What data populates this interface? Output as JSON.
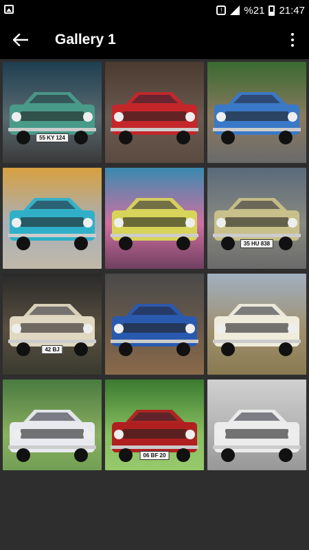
{
  "status_bar": {
    "battery_percent": "%21",
    "time": "21:47"
  },
  "app_bar": {
    "title": "Gallery 1",
    "back_icon": "arrow-left-icon",
    "more_icon": "more-vert-icon"
  },
  "gallery": {
    "items": [
      {
        "plate": "55 KY 124",
        "car_color": "#4a9a8a"
      },
      {
        "plate": "",
        "car_color": "#c4262a"
      },
      {
        "plate": "",
        "car_color": "#3a78c8"
      },
      {
        "plate": "",
        "car_color": "#2fb0c8"
      },
      {
        "plate": "",
        "car_color": "#d8d45a"
      },
      {
        "plate": "35 HU 838",
        "car_color": "#c8c08a"
      },
      {
        "plate": "42 BJ",
        "car_color": "#e0d8c0"
      },
      {
        "plate": "",
        "car_color": "#2a5ab0"
      },
      {
        "plate": "",
        "car_color": "#f0ecdc"
      },
      {
        "plate": "",
        "car_color": "#e8eaf0"
      },
      {
        "plate": "06 BF 20",
        "car_color": "#b02020"
      },
      {
        "plate": "",
        "car_color": "#ececec"
      }
    ]
  }
}
